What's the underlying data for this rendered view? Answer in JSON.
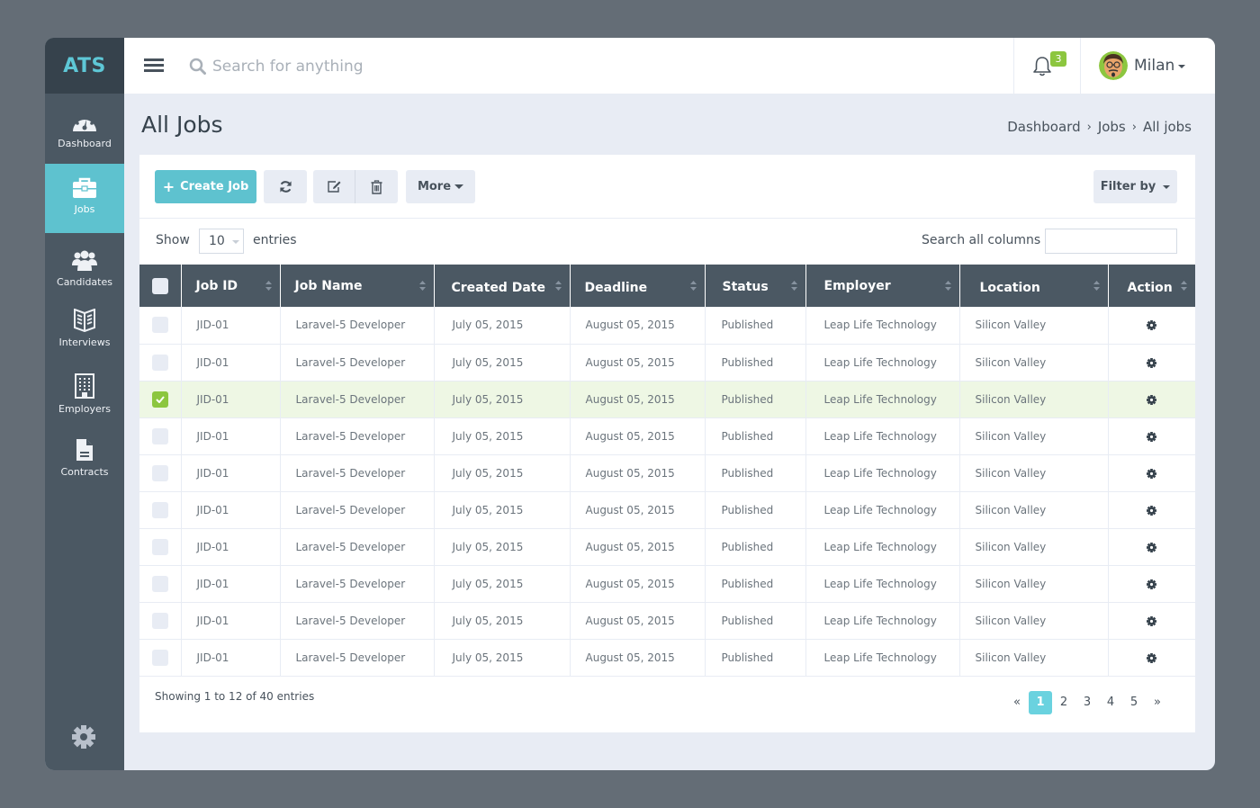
{
  "app": {
    "logo": "ATS"
  },
  "sidebar": {
    "items": [
      {
        "label": "Dashboard",
        "icon": "dashboard-icon"
      },
      {
        "label": "Jobs",
        "icon": "briefcase-icon",
        "active": true
      },
      {
        "label": "Candidates",
        "icon": "users-icon"
      },
      {
        "label": "Interviews",
        "icon": "book-icon"
      },
      {
        "label": "Employers",
        "icon": "building-icon"
      },
      {
        "label": "Contracts",
        "icon": "document-icon"
      }
    ],
    "settings_icon": "gear-icon"
  },
  "topbar": {
    "search_placeholder": "Search for anything",
    "notification_count": "3",
    "user_name": "Milan"
  },
  "page": {
    "title": "All Jobs",
    "breadcrumb": [
      "Dashboard",
      "Jobs",
      "All jobs"
    ]
  },
  "toolbar": {
    "create_label": "Create Job",
    "more_label": "More",
    "filter_label": "Filter by"
  },
  "table_controls": {
    "show_label": "Show",
    "entries_label": "entries",
    "page_length": "10",
    "search_label": "Search all columns",
    "search_value": ""
  },
  "table": {
    "columns": [
      "Job ID",
      "Job Name",
      "Created Date",
      "Deadline",
      "Status",
      "Employer",
      "Location",
      "Action"
    ],
    "rows": [
      {
        "id": "JID-01",
        "name": "Laravel-5 Developer",
        "created": "July 05, 2015",
        "deadline": "August 05, 2015",
        "status": "Published",
        "employer": "Leap Life Technology",
        "location": "Silicon Valley",
        "checked": false
      },
      {
        "id": "JID-01",
        "name": "Laravel-5 Developer",
        "created": "July 05, 2015",
        "deadline": "August 05, 2015",
        "status": "Published",
        "employer": "Leap Life Technology",
        "location": "Silicon Valley",
        "checked": false
      },
      {
        "id": "JID-01",
        "name": "Laravel-5 Developer",
        "created": "July 05, 2015",
        "deadline": "August 05, 2015",
        "status": "Published",
        "employer": "Leap Life Technology",
        "location": "Silicon Valley",
        "checked": true
      },
      {
        "id": "JID-01",
        "name": "Laravel-5 Developer",
        "created": "July 05, 2015",
        "deadline": "August 05, 2015",
        "status": "Published",
        "employer": "Leap Life Technology",
        "location": "Silicon Valley",
        "checked": false
      },
      {
        "id": "JID-01",
        "name": "Laravel-5 Developer",
        "created": "July 05, 2015",
        "deadline": "August 05, 2015",
        "status": "Published",
        "employer": "Leap Life Technology",
        "location": "Silicon Valley",
        "checked": false
      },
      {
        "id": "JID-01",
        "name": "Laravel-5 Developer",
        "created": "July 05, 2015",
        "deadline": "August 05, 2015",
        "status": "Published",
        "employer": "Leap Life Technology",
        "location": "Silicon Valley",
        "checked": false
      },
      {
        "id": "JID-01",
        "name": "Laravel-5 Developer",
        "created": "July 05, 2015",
        "deadline": "August 05, 2015",
        "status": "Published",
        "employer": "Leap Life Technology",
        "location": "Silicon Valley",
        "checked": false
      },
      {
        "id": "JID-01",
        "name": "Laravel-5 Developer",
        "created": "July 05, 2015",
        "deadline": "August 05, 2015",
        "status": "Published",
        "employer": "Leap Life Technology",
        "location": "Silicon Valley",
        "checked": false
      },
      {
        "id": "JID-01",
        "name": "Laravel-5 Developer",
        "created": "July 05, 2015",
        "deadline": "August 05, 2015",
        "status": "Published",
        "employer": "Leap Life Technology",
        "location": "Silicon Valley",
        "checked": false
      },
      {
        "id": "JID-01",
        "name": "Laravel-5 Developer",
        "created": "July 05, 2015",
        "deadline": "August 05, 2015",
        "status": "Published",
        "employer": "Leap Life Technology",
        "location": "Silicon Valley",
        "checked": false
      }
    ]
  },
  "footer": {
    "info": "Showing 1 to 12 of 40 entries",
    "prev": "«",
    "next": "»",
    "pages": [
      "1",
      "2",
      "3",
      "4",
      "5"
    ],
    "current_page": "1"
  },
  "colors": {
    "accent": "#5ec2cf",
    "sidebar": "#4b5863",
    "success": "#8cc63f",
    "selected_row": "#eef7e4"
  }
}
